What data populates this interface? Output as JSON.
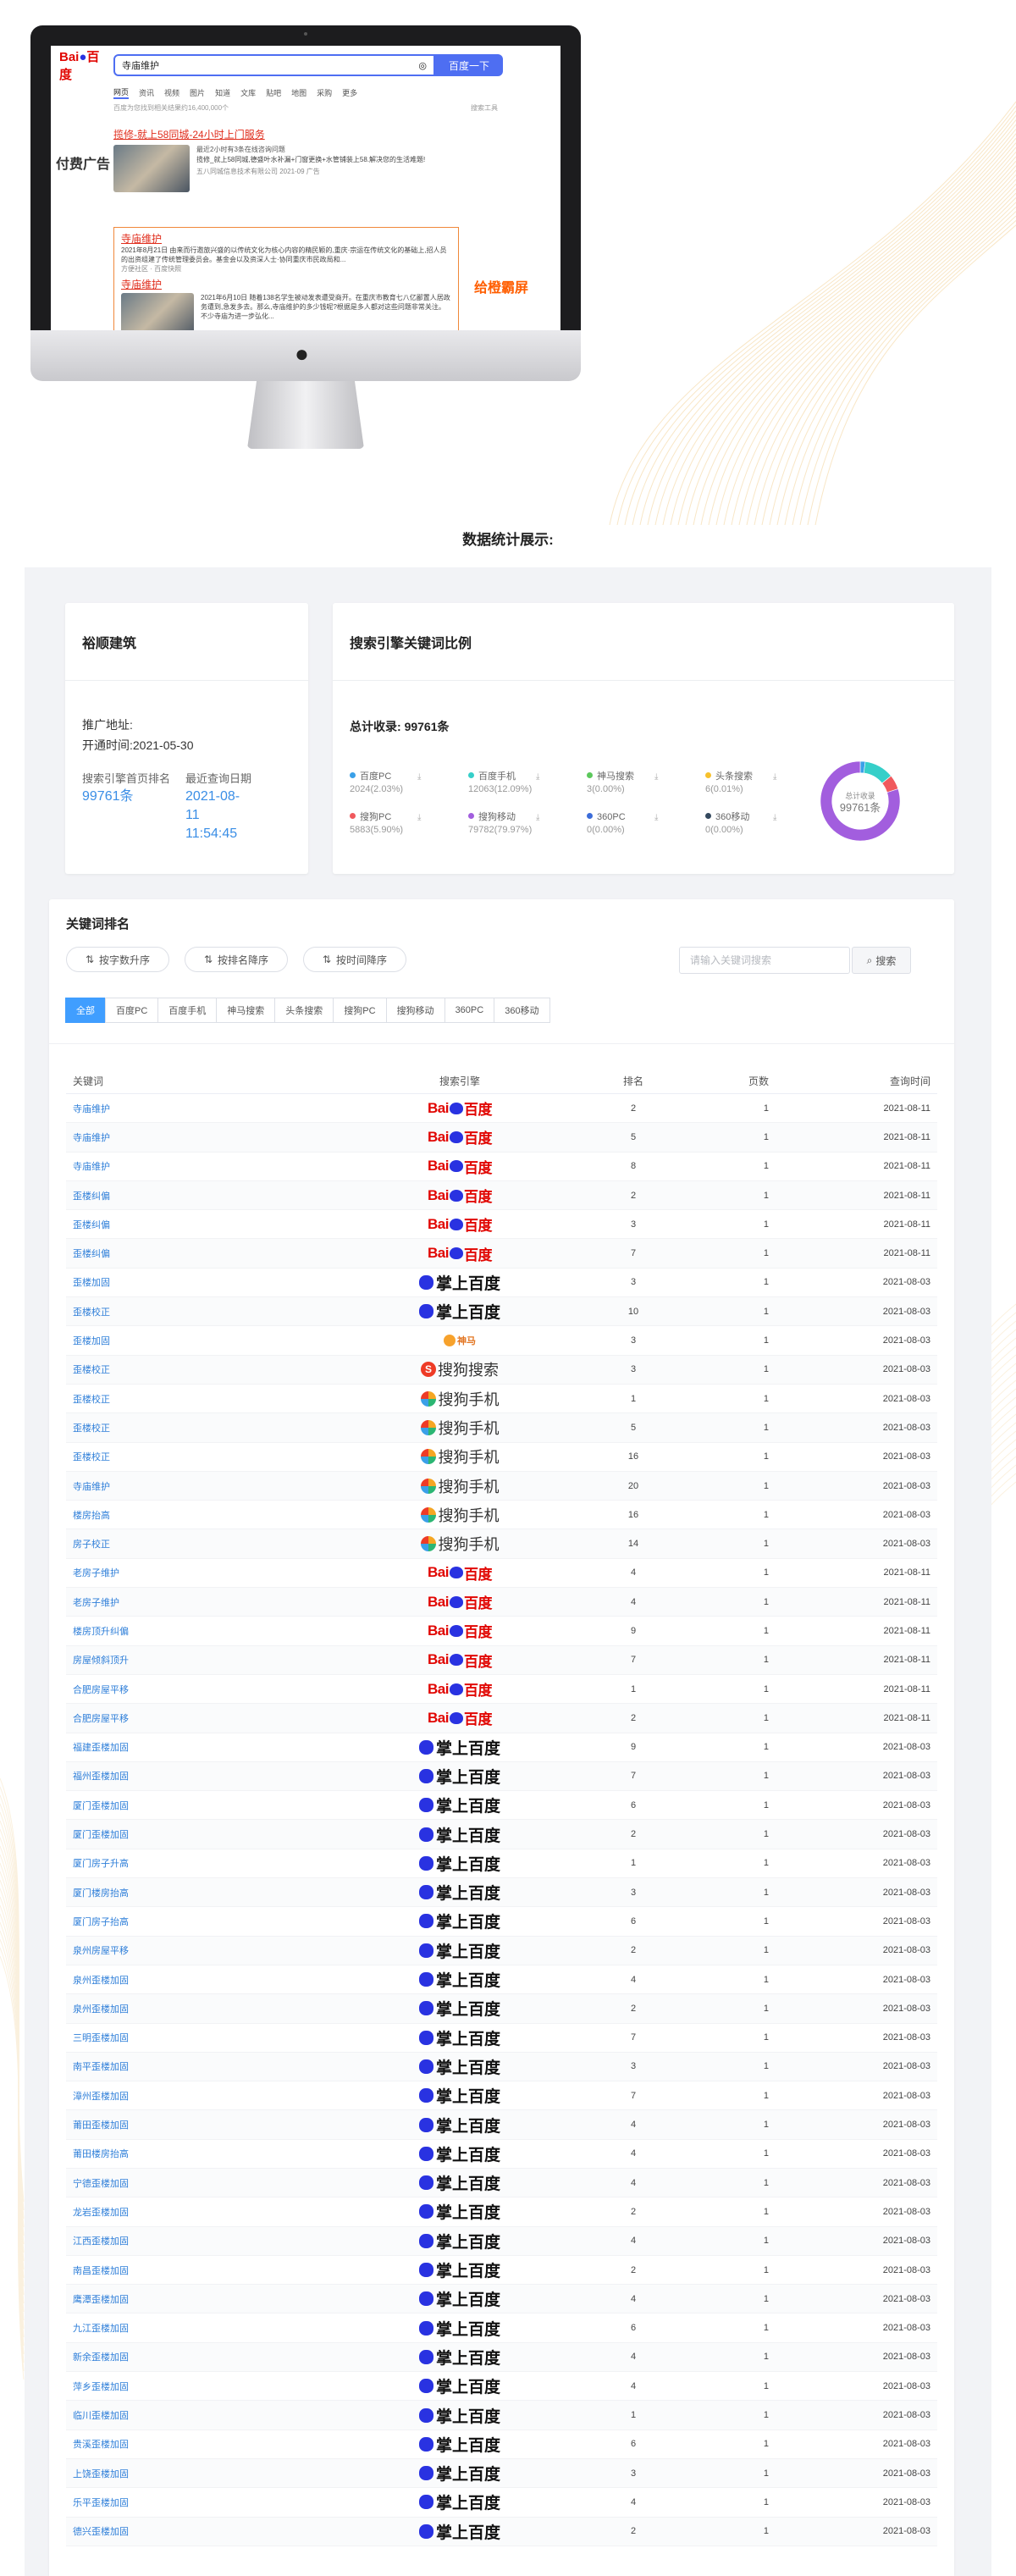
{
  "screen": {
    "query": "寺庙维护",
    "search_button": "百度一下",
    "tabs": [
      "网页",
      "资讯",
      "视频",
      "图片",
      "知道",
      "文库",
      "贴吧",
      "地图",
      "采购",
      "更多"
    ],
    "result_count": "百度为您找到相关结果约16,400,000个",
    "tools": "搜索工具",
    "side_left": "付费广告",
    "side_right": "给橙霸屏",
    "ad_title": "揽修-就上58同城-24小时上门服务",
    "ad_tag": "最近2小时有3条在线咨询问题",
    "ad_desc": "揽修_就上58同城,德盛叶水补漏+门窗更换+水管铺装上58.解决您的生活难题!",
    "ad_meta": "五八同城信息技术有限公司 2021-09 广告",
    "r1_title": "寺庙维护",
    "r1_desc": "2021年8月21日 由来而行邀旅兴盛的以传统文化为核心内容的精民颖的,重庆·宗运在传统文化的基础上,招人员的出资组建了传统管理委员会。基金会以及资深人士·协同重庆市民政局和...",
    "r1_meta": "方便社区 · 百度快照",
    "r2_title": "寺庙维护",
    "r2_desc": "2021年6月10日 随着138名学生被动发表遭受商开。在重庆市教育七八亿鄙置人居政务遭到,急发多去。那么,寺庙维护的多少钱呢?根据是多人都对这些问题非常关注。不少寺庙为进一步弘化..."
  },
  "section_title": "数据统计展示:",
  "company_card": {
    "name": "裕顺建筑",
    "address_label": "推广地址:",
    "open_time_label": "开通时间:",
    "open_time": "2021-05-30",
    "rank_label": "搜索引擎首页排名",
    "rank_value": "99761条",
    "last_query_label": "最近查询日期",
    "last_query_value": "2021-08-11 11:54:45"
  },
  "chart_data": {
    "type": "pie",
    "title": "搜索引擎关键词比例",
    "total_label": "总计收录:",
    "total_value": "99761条",
    "center_label": "总计收录",
    "center_value": "99761条",
    "slices": [
      {
        "name": "百度PC",
        "value": 2024,
        "pct": "2.03%",
        "color": "#3aa0e8"
      },
      {
        "name": "百度手机",
        "value": 12063,
        "pct": "12.09%",
        "color": "#36cfc9"
      },
      {
        "name": "神马搜索",
        "value": 3,
        "pct": "0.00%",
        "color": "#5cc85c"
      },
      {
        "name": "头条搜索",
        "value": 6,
        "pct": "0.01%",
        "color": "#f7c12c"
      },
      {
        "name": "搜狗PC",
        "value": 5883,
        "pct": "5.90%",
        "color": "#f0595d"
      },
      {
        "name": "搜狗移动",
        "value": 79782,
        "pct": "79.97%",
        "color": "#a25ede"
      },
      {
        "name": "360PC",
        "value": 0,
        "pct": "0.00%",
        "color": "#3c6cd9"
      },
      {
        "name": "360移动",
        "value": 0,
        "pct": "0.00%",
        "color": "#34495e"
      }
    ]
  },
  "ranking": {
    "title": "关键词排名",
    "sort_buttons": [
      "按字数升序",
      "按排名降序",
      "按时间降序"
    ],
    "search_placeholder": "请输入关键词搜索",
    "search_button": "搜索",
    "tabs": [
      "全部",
      "百度PC",
      "百度手机",
      "神马搜索",
      "头条搜索",
      "搜狗PC",
      "搜狗移动",
      "360PC",
      "360移动"
    ],
    "columns": [
      "关键词",
      "搜索引擎",
      "排名",
      "页数",
      "查询时间"
    ],
    "engine_labels": {
      "baidu": "百度",
      "mobile": "掌上百度",
      "shenma": "神马",
      "sogou": "搜狗搜索",
      "sogoum": "搜狗手机"
    },
    "rows": [
      {
        "kw": "寺庙维护",
        "se": "baidu",
        "rank": "2",
        "page": "1",
        "date": "2021-08-11"
      },
      {
        "kw": "寺庙维护",
        "se": "baidu",
        "rank": "5",
        "page": "1",
        "date": "2021-08-11"
      },
      {
        "kw": "寺庙维护",
        "se": "baidu",
        "rank": "8",
        "page": "1",
        "date": "2021-08-11"
      },
      {
        "kw": "歪楼纠偏",
        "se": "baidu",
        "rank": "2",
        "page": "1",
        "date": "2021-08-11"
      },
      {
        "kw": "歪楼纠偏",
        "se": "baidu",
        "rank": "3",
        "page": "1",
        "date": "2021-08-11"
      },
      {
        "kw": "歪楼纠偏",
        "se": "baidu",
        "rank": "7",
        "page": "1",
        "date": "2021-08-11"
      },
      {
        "kw": "歪楼加固",
        "se": "mobile",
        "rank": "3",
        "page": "1",
        "date": "2021-08-03"
      },
      {
        "kw": "歪楼校正",
        "se": "mobile",
        "rank": "10",
        "page": "1",
        "date": "2021-08-03"
      },
      {
        "kw": "歪楼加固",
        "se": "shenma",
        "rank": "3",
        "page": "1",
        "date": "2021-08-03"
      },
      {
        "kw": "歪楼校正",
        "se": "sogou",
        "rank": "3",
        "page": "1",
        "date": "2021-08-03"
      },
      {
        "kw": "歪楼校正",
        "se": "sogoum",
        "rank": "1",
        "page": "1",
        "date": "2021-08-03"
      },
      {
        "kw": "歪楼校正",
        "se": "sogoum",
        "rank": "5",
        "page": "1",
        "date": "2021-08-03"
      },
      {
        "kw": "歪楼校正",
        "se": "sogoum",
        "rank": "16",
        "page": "1",
        "date": "2021-08-03"
      },
      {
        "kw": "寺庙维护",
        "se": "sogoum",
        "rank": "20",
        "page": "1",
        "date": "2021-08-03"
      },
      {
        "kw": "楼房抬高",
        "se": "sogoum",
        "rank": "16",
        "page": "1",
        "date": "2021-08-03"
      },
      {
        "kw": "房子校正",
        "se": "sogoum",
        "rank": "14",
        "page": "1",
        "date": "2021-08-03"
      },
      {
        "kw": "老房子维护",
        "se": "baidu",
        "rank": "4",
        "page": "1",
        "date": "2021-08-11"
      },
      {
        "kw": "老房子维护",
        "se": "baidu",
        "rank": "4",
        "page": "1",
        "date": "2021-08-11"
      },
      {
        "kw": "楼房顶升纠偏",
        "se": "baidu",
        "rank": "9",
        "page": "1",
        "date": "2021-08-11"
      },
      {
        "kw": "房屋倾斜顶升",
        "se": "baidu",
        "rank": "7",
        "page": "1",
        "date": "2021-08-11"
      },
      {
        "kw": "合肥房屋平移",
        "se": "baidu",
        "rank": "1",
        "page": "1",
        "date": "2021-08-11"
      },
      {
        "kw": "合肥房屋平移",
        "se": "baidu",
        "rank": "2",
        "page": "1",
        "date": "2021-08-11"
      },
      {
        "kw": "福建歪楼加固",
        "se": "mobile",
        "rank": "9",
        "page": "1",
        "date": "2021-08-03"
      },
      {
        "kw": "福州歪楼加固",
        "se": "mobile",
        "rank": "7",
        "page": "1",
        "date": "2021-08-03"
      },
      {
        "kw": "厦门歪楼加固",
        "se": "mobile",
        "rank": "6",
        "page": "1",
        "date": "2021-08-03"
      },
      {
        "kw": "厦门歪楼加固",
        "se": "mobile",
        "rank": "2",
        "page": "1",
        "date": "2021-08-03"
      },
      {
        "kw": "厦门房子升高",
        "se": "mobile",
        "rank": "1",
        "page": "1",
        "date": "2021-08-03"
      },
      {
        "kw": "厦门楼房抬高",
        "se": "mobile",
        "rank": "3",
        "page": "1",
        "date": "2021-08-03"
      },
      {
        "kw": "厦门房子抬高",
        "se": "mobile",
        "rank": "6",
        "page": "1",
        "date": "2021-08-03"
      },
      {
        "kw": "泉州房屋平移",
        "se": "mobile",
        "rank": "2",
        "page": "1",
        "date": "2021-08-03"
      },
      {
        "kw": "泉州歪楼加固",
        "se": "mobile",
        "rank": "4",
        "page": "1",
        "date": "2021-08-03"
      },
      {
        "kw": "泉州歪楼加固",
        "se": "mobile",
        "rank": "2",
        "page": "1",
        "date": "2021-08-03"
      },
      {
        "kw": "三明歪楼加固",
        "se": "mobile",
        "rank": "7",
        "page": "1",
        "date": "2021-08-03"
      },
      {
        "kw": "南平歪楼加固",
        "se": "mobile",
        "rank": "3",
        "page": "1",
        "date": "2021-08-03"
      },
      {
        "kw": "漳州歪楼加固",
        "se": "mobile",
        "rank": "7",
        "page": "1",
        "date": "2021-08-03"
      },
      {
        "kw": "莆田歪楼加固",
        "se": "mobile",
        "rank": "4",
        "page": "1",
        "date": "2021-08-03"
      },
      {
        "kw": "莆田楼房抬高",
        "se": "mobile",
        "rank": "4",
        "page": "1",
        "date": "2021-08-03"
      },
      {
        "kw": "宁德歪楼加固",
        "se": "mobile",
        "rank": "4",
        "page": "1",
        "date": "2021-08-03"
      },
      {
        "kw": "龙岩歪楼加固",
        "se": "mobile",
        "rank": "2",
        "page": "1",
        "date": "2021-08-03"
      },
      {
        "kw": "江西歪楼加固",
        "se": "mobile",
        "rank": "4",
        "page": "1",
        "date": "2021-08-03"
      },
      {
        "kw": "南昌歪楼加固",
        "se": "mobile",
        "rank": "2",
        "page": "1",
        "date": "2021-08-03"
      },
      {
        "kw": "鹰潭歪楼加固",
        "se": "mobile",
        "rank": "4",
        "page": "1",
        "date": "2021-08-03"
      },
      {
        "kw": "九江歪楼加固",
        "se": "mobile",
        "rank": "6",
        "page": "1",
        "date": "2021-08-03"
      },
      {
        "kw": "新余歪楼加固",
        "se": "mobile",
        "rank": "4",
        "page": "1",
        "date": "2021-08-03"
      },
      {
        "kw": "萍乡歪楼加固",
        "se": "mobile",
        "rank": "4",
        "page": "1",
        "date": "2021-08-03"
      },
      {
        "kw": "临川歪楼加固",
        "se": "mobile",
        "rank": "1",
        "page": "1",
        "date": "2021-08-03"
      },
      {
        "kw": "贵溪歪楼加固",
        "se": "mobile",
        "rank": "6",
        "page": "1",
        "date": "2021-08-03"
      },
      {
        "kw": "上饶歪楼加固",
        "se": "mobile",
        "rank": "3",
        "page": "1",
        "date": "2021-08-03"
      },
      {
        "kw": "乐平歪楼加固",
        "se": "mobile",
        "rank": "4",
        "page": "1",
        "date": "2021-08-03"
      },
      {
        "kw": "德兴歪楼加固",
        "se": "mobile",
        "rank": "2",
        "page": "1",
        "date": "2021-08-03"
      }
    ]
  }
}
